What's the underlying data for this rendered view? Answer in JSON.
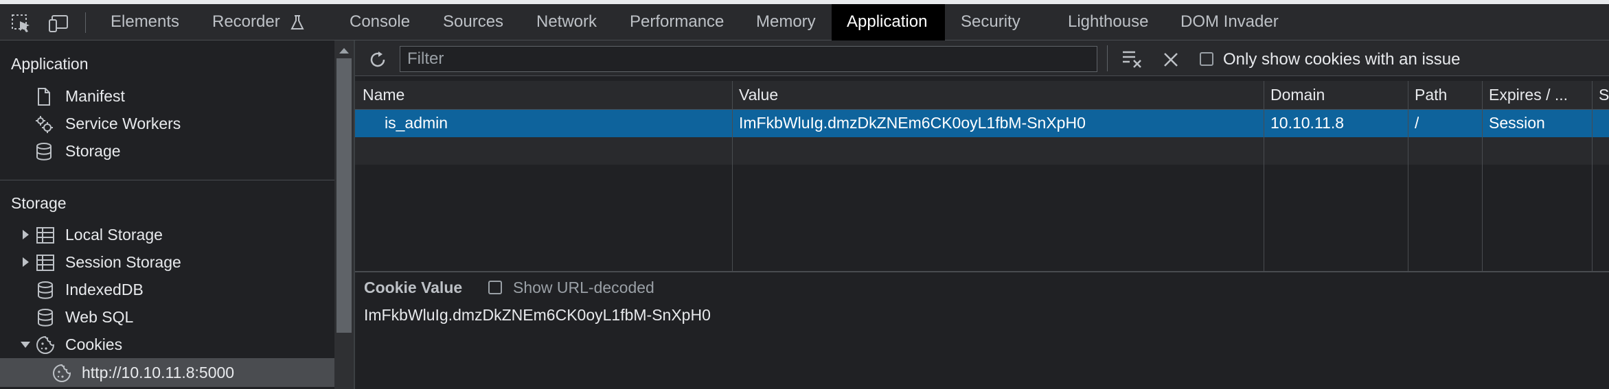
{
  "tabs": [
    {
      "label": "Elements"
    },
    {
      "label": "Recorder"
    },
    {
      "label": "Console"
    },
    {
      "label": "Sources"
    },
    {
      "label": "Network"
    },
    {
      "label": "Performance"
    },
    {
      "label": "Memory"
    },
    {
      "label": "Application"
    },
    {
      "label": "Security"
    },
    {
      "label": "Lighthouse"
    },
    {
      "label": "DOM Invader"
    }
  ],
  "active_tab": "Application",
  "sidebar": {
    "application_heading": "Application",
    "application_items": [
      {
        "label": "Manifest",
        "icon": "document-icon"
      },
      {
        "label": "Service Workers",
        "icon": "gears-icon"
      },
      {
        "label": "Storage",
        "icon": "database-icon"
      }
    ],
    "storage_heading": "Storage",
    "storage_items": [
      {
        "label": "Local Storage",
        "icon": "table-icon",
        "expandable": "collapsed"
      },
      {
        "label": "Session Storage",
        "icon": "table-icon",
        "expandable": "collapsed"
      },
      {
        "label": "IndexedDB",
        "icon": "database-icon"
      },
      {
        "label": "Web SQL",
        "icon": "database-icon"
      },
      {
        "label": "Cookies",
        "icon": "cookie-icon",
        "expandable": "expanded"
      }
    ],
    "cookie_origin": "http://10.10.11.8:5000"
  },
  "toolbar": {
    "filter_placeholder": "Filter",
    "issue_checkbox_label": "Only show cookies with an issue"
  },
  "table": {
    "columns": [
      "Name",
      "Value",
      "Domain",
      "Path",
      "Expires / ...",
      "S"
    ],
    "rows": [
      {
        "name": "is_admin",
        "value": "ImFkbWluIg.dmzDkZNEm6CK0oyL1fbM-SnXpH0",
        "domain": "10.10.11.8",
        "path": "/",
        "expires": "Session"
      }
    ]
  },
  "detail": {
    "title": "Cookie Value",
    "url_decoded_label": "Show URL-decoded",
    "value": "ImFkbWluIg.dmzDkZNEm6CK0oyL1fbM-SnXpH0"
  },
  "colors": {
    "selected_row": "#0e639c",
    "active_tab_bg": "#000000",
    "panel_bg": "#202124"
  }
}
